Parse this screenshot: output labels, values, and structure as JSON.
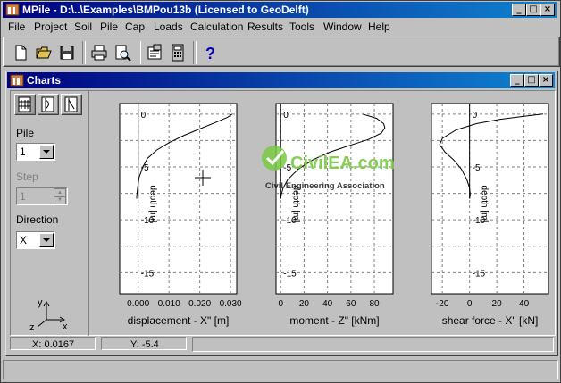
{
  "app": {
    "title": "MPile - D:\\..\\Examples\\BMPou13b (Licensed to GeoDelft)",
    "menu": [
      "File",
      "Project",
      "Soil",
      "Pile",
      "Cap",
      "Loads",
      "Calculation",
      "Results",
      "Tools",
      "Window",
      "Help"
    ],
    "toolbar_icons": [
      "new-file-icon",
      "open-folder-icon",
      "save-icon",
      "print-icon",
      "print-preview-icon",
      "properties-icon",
      "calculator-icon",
      "help-icon"
    ]
  },
  "charts_window": {
    "title": "Charts",
    "view_icons": [
      "bookmark-mode-icon",
      "chart-view-icon",
      "chart-edit-icon"
    ],
    "pile_label": "Pile",
    "pile_value": "1",
    "step_label": "Step",
    "step_value": "1",
    "direction_label": "Direction",
    "direction_value": "X",
    "axes_icon_labels": {
      "y": "y",
      "x": "x",
      "z": "z"
    },
    "status": {
      "x": "X: 0.0167",
      "y": "Y: -5.4"
    }
  },
  "watermark": {
    "name": "CivilEA.com",
    "subtitle": "Civil Engineering Association"
  },
  "chart_data": [
    {
      "type": "line",
      "xlabel": "displacement - X\" [m]",
      "ylabel": "depth [m]",
      "xlim": [
        -0.006,
        0.032
      ],
      "ylim": [
        -17,
        1
      ],
      "xticks": [
        "0.000",
        "0.010",
        "0.020",
        "0.030"
      ],
      "xtick_values": [
        0,
        0.01,
        0.02,
        0.03
      ],
      "yticks": [
        "0",
        "-5",
        "-10",
        "-15"
      ],
      "ytick_values": [
        0,
        -5,
        -10,
        -15
      ],
      "grid": true,
      "x": [
        0.0305,
        0.029,
        0.025,
        0.02,
        0.015,
        0.01,
        0.006,
        0.003,
        0.0015,
        0.0003,
        -0.0002,
        -0.0004,
        -0.0005,
        -0.0005
      ],
      "y": [
        0,
        -0.3,
        -0.8,
        -1.4,
        -2.0,
        -2.7,
        -3.4,
        -4.2,
        -5.0,
        -6.0,
        -7.0,
        -7.6,
        -7.8,
        -8.0
      ],
      "pile_cap_y": -8.0
    },
    {
      "type": "line",
      "xlabel": "moment - Z\" [kNm]",
      "ylabel": "depth [m]",
      "xlim": [
        -4,
        96
      ],
      "ylim": [
        -17,
        1
      ],
      "xticks": [
        "0",
        "20",
        "40",
        "60",
        "80"
      ],
      "xtick_values": [
        0,
        20,
        40,
        60,
        80
      ],
      "yticks": [
        "0",
        "-5",
        "-10",
        "-15"
      ],
      "ytick_values": [
        0,
        -5,
        -10,
        -15
      ],
      "grid": true,
      "x": [
        70,
        82,
        88,
        89,
        86,
        75,
        58,
        42,
        28,
        15,
        6,
        2,
        0.5,
        0
      ],
      "y": [
        0,
        -0.4,
        -0.9,
        -1.3,
        -1.8,
        -2.4,
        -3.0,
        -3.6,
        -4.3,
        -5.2,
        -6.2,
        -7.0,
        -7.6,
        -8.0
      ],
      "pile_cap_y": -8.0
    },
    {
      "type": "line",
      "xlabel": "shear force - X\" [kN]",
      "ylabel": "depth [m]",
      "xlim": [
        -28,
        58
      ],
      "ylim": [
        -17,
        1
      ],
      "xticks": [
        "-20",
        "0",
        "20",
        "40"
      ],
      "xtick_values": [
        -20,
        0,
        20,
        40
      ],
      "yticks": [
        "0",
        "-5",
        "-10",
        "-15"
      ],
      "ytick_values": [
        0,
        -5,
        -10,
        -15
      ],
      "grid": true,
      "x": [
        54,
        40,
        22,
        5,
        -10,
        -20,
        -22,
        -18,
        -12,
        -6,
        -2,
        0,
        0.5,
        0
      ],
      "y": [
        0,
        -0.2,
        -0.5,
        -0.9,
        -1.5,
        -2.3,
        -2.9,
        -3.6,
        -4.3,
        -5.2,
        -6.2,
        -7.0,
        -7.6,
        -8.0
      ],
      "pile_cap_y": -8.0
    }
  ]
}
